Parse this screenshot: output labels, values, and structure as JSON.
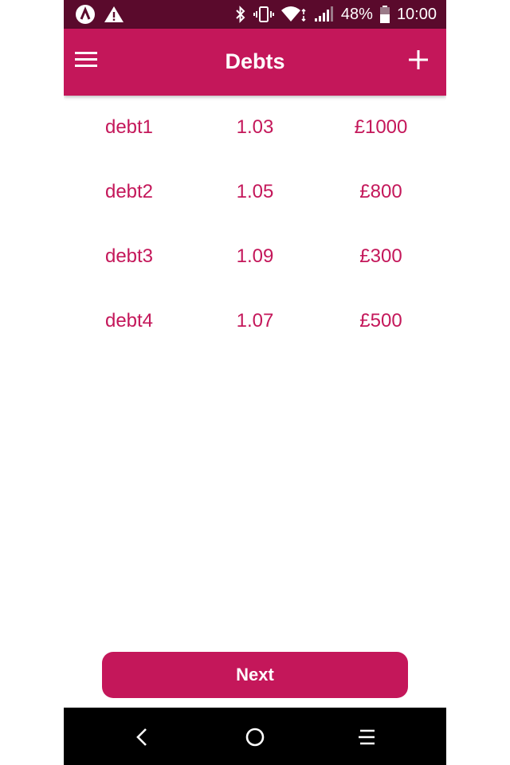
{
  "status_bar": {
    "battery": "48%",
    "time": "10:00",
    "icons": [
      "app-a-icon",
      "warning-icon",
      "bluetooth-icon",
      "vibrate-icon",
      "wifi-icon",
      "signal-icon",
      "battery-icon"
    ]
  },
  "app_bar": {
    "title": "Debts",
    "menu_icon": "menu-icon",
    "add_icon": "plus-icon"
  },
  "debts": [
    {
      "name": "debt1",
      "rate": "1.03",
      "amount": "£1000"
    },
    {
      "name": "debt2",
      "rate": "1.05",
      "amount": "£800"
    },
    {
      "name": "debt3",
      "rate": "1.09",
      "amount": "£300"
    },
    {
      "name": "debt4",
      "rate": "1.07",
      "amount": "£500"
    }
  ],
  "footer": {
    "next_label": "Next"
  },
  "nav_bar": {
    "icons": [
      "back-icon",
      "home-icon",
      "recent-apps-icon"
    ]
  },
  "colors": {
    "primary": "#c4175a",
    "status_bar": "#5a0a2c",
    "nav_bar": "#000000"
  }
}
